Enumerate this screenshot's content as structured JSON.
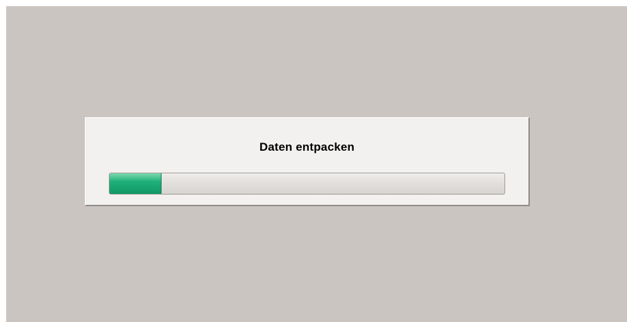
{
  "dialog": {
    "title": "Daten entpacken"
  },
  "progress": {
    "value": 0.13,
    "color": "#119866"
  },
  "colors": {
    "desktop_background": "#cbc5c2",
    "dialog_background": "#f3f1ef"
  }
}
